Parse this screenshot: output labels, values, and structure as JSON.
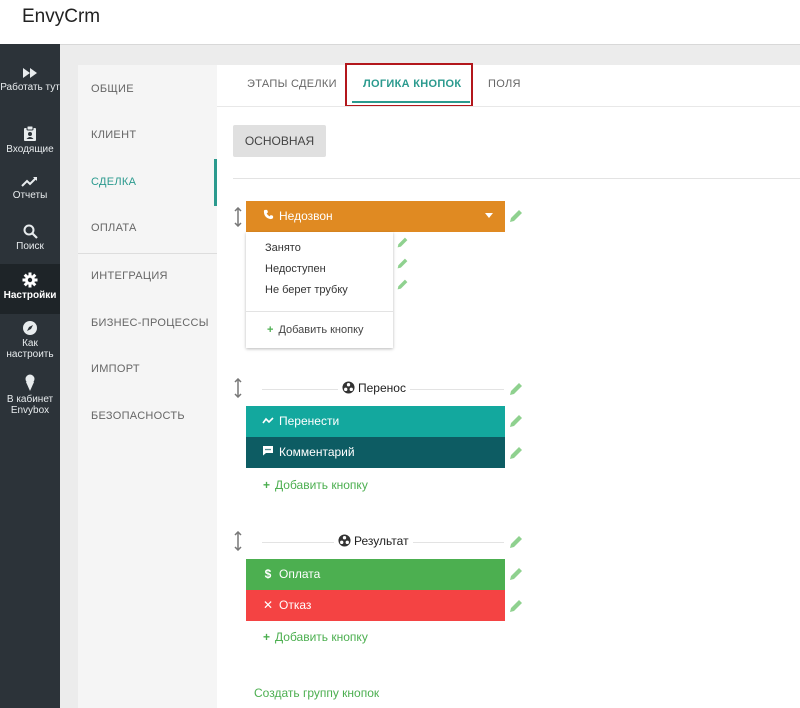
{
  "app": {
    "title": "EnvyCrm"
  },
  "leftnav": [
    {
      "label": "Работать тут",
      "icon": "fast-forward-icon"
    },
    {
      "label": "Входящие",
      "icon": "clipboard-icon"
    },
    {
      "label": "Отчеты",
      "icon": "trend-icon"
    },
    {
      "label": "Поиск",
      "icon": "search-icon"
    },
    {
      "label": "Настройки",
      "icon": "gear-icon",
      "active": true
    },
    {
      "label": "Как настроить",
      "icon": "compass-icon"
    },
    {
      "label": "В кабинет Envybox",
      "icon": "ice-cream-icon"
    }
  ],
  "settings_menu": [
    "ОБЩИЕ",
    "КЛИЕНТ",
    "СДЕЛКА",
    "ОПЛАТА",
    "ИНТЕГРАЦИЯ",
    "БИЗНЕС-ПРОЦЕССЫ",
    "ИМПОРТ",
    "БЕЗОПАСНОСТЬ"
  ],
  "settings_menu_active": "СДЕЛКА",
  "tabs": [
    "ЭТАПЫ СДЕЛКИ",
    "ЛОГИКА КНОПОК",
    "ПОЛЯ"
  ],
  "active_tab": "ЛОГИКА КНОПОК",
  "subtab": "ОСНОВНАЯ",
  "group1": {
    "button": {
      "label": "Недозвон",
      "icon": "phone-icon",
      "color": "#e08a22"
    },
    "dropdown_items": [
      "Занято",
      "Недоступен",
      "Не берет трубку"
    ],
    "add_label": "Добавить кнопку"
  },
  "group2": {
    "title": "Перенос",
    "buttons": [
      {
        "label": "Перенести",
        "icon": "trend-icon",
        "color": "#13a89e"
      },
      {
        "label": "Комментарий",
        "icon": "comment-icon",
        "color": "#0d5c63"
      }
    ],
    "add_label": "Добавить кнопку"
  },
  "group3": {
    "title": "Результат",
    "buttons": [
      {
        "label": "Оплата",
        "icon": "dollar-icon",
        "color": "#4caf50"
      },
      {
        "label": "Отказ",
        "icon": "close-icon",
        "color": "#f44343"
      }
    ],
    "add_label": "Добавить кнопку"
  },
  "create_group_label": "Создать группу кнопок",
  "colors": {
    "accent": "#2b9a8e",
    "highlight": "#b3171c",
    "add_green": "#4caf50",
    "nav_bg": "#2c3339"
  }
}
